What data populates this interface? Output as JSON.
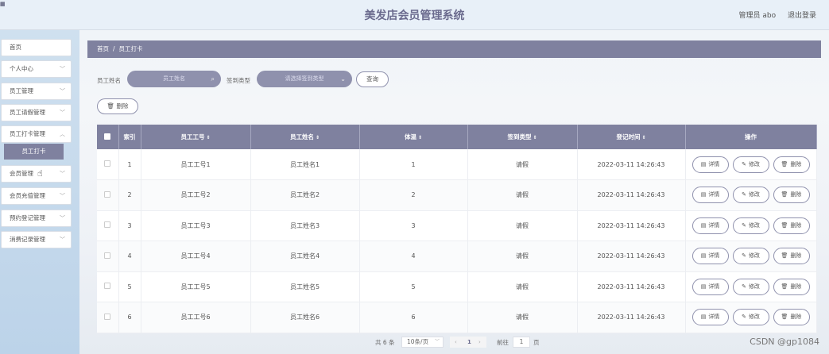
{
  "window": {
    "corner_icon": "app-icon"
  },
  "header": {
    "title": "美发店会员管理系统",
    "admin_label": "管理员 abo",
    "logout": "退出登录"
  },
  "sidebar": {
    "items": [
      {
        "label": "首页"
      },
      {
        "label": "个人中心"
      },
      {
        "label": "员工管理"
      },
      {
        "label": "员工请假管理"
      },
      {
        "label": "员工打卡管理"
      },
      {
        "label": "会员管理"
      },
      {
        "label": "会员充值管理"
      },
      {
        "label": "预约登记管理"
      },
      {
        "label": "消费记录管理"
      }
    ],
    "active_sub": "员工打卡"
  },
  "breadcrumb": {
    "home": "首页",
    "sep": "/",
    "current": "员工打卡"
  },
  "search": {
    "name_label": "员工姓名",
    "name_placeholder": "员工姓名",
    "type_label": "签到类型",
    "type_placeholder": "请选择签到类型",
    "query_button": "查询",
    "delete_button": "删除"
  },
  "table": {
    "headers": {
      "index": "索引",
      "emp_no": "员工工号",
      "emp_name": "员工姓名",
      "temp": "体温",
      "type": "签到类型",
      "time": "登记时间",
      "ops": "操作"
    },
    "rows": [
      {
        "index": "1",
        "emp_no": "员工工号1",
        "emp_name": "员工姓名1",
        "temp": "1",
        "type": "请假",
        "time": "2022-03-11 14:26:43"
      },
      {
        "index": "2",
        "emp_no": "员工工号2",
        "emp_name": "员工姓名2",
        "temp": "2",
        "type": "请假",
        "time": "2022-03-11 14:26:43"
      },
      {
        "index": "3",
        "emp_no": "员工工号3",
        "emp_name": "员工姓名3",
        "temp": "3",
        "type": "请假",
        "time": "2022-03-11 14:26:43"
      },
      {
        "index": "4",
        "emp_no": "员工工号4",
        "emp_name": "员工姓名4",
        "temp": "4",
        "type": "请假",
        "time": "2022-03-11 14:26:43"
      },
      {
        "index": "5",
        "emp_no": "员工工号5",
        "emp_name": "员工姓名5",
        "temp": "5",
        "type": "请假",
        "time": "2022-03-11 14:26:43"
      },
      {
        "index": "6",
        "emp_no": "员工工号6",
        "emp_name": "员工姓名6",
        "temp": "6",
        "type": "请假",
        "time": "2022-03-11 14:26:43"
      }
    ],
    "ops": {
      "detail": "详情",
      "edit": "修改",
      "delete": "删除"
    }
  },
  "pager": {
    "total": "共 6 条",
    "page_size": "10条/页",
    "current_page": "1",
    "goto_label": "前往",
    "goto_value": "1",
    "page_word": "页"
  },
  "watermark": "CSDN @gp1084",
  "colors": {
    "accent": "#7f819f",
    "pill": "#8f91ad",
    "title": "#6b6b8e"
  }
}
